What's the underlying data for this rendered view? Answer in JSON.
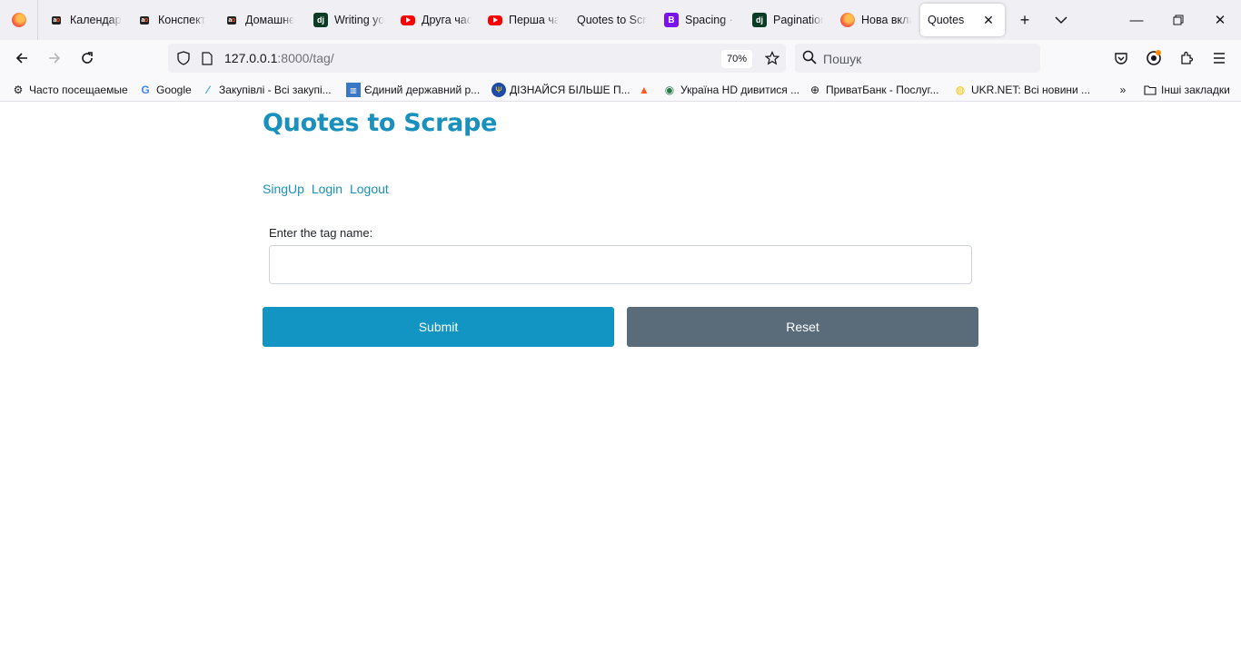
{
  "browser": {
    "tabs": [
      {
        "label": "Календар",
        "icon": "aotv-icon"
      },
      {
        "label": "Конспект",
        "icon": "aotv-icon"
      },
      {
        "label": "Домашнє",
        "icon": "aotv-icon"
      },
      {
        "label": "Writing your",
        "icon": "django-icon"
      },
      {
        "label": "Друга час",
        "icon": "youtube-icon"
      },
      {
        "label": "Перша час",
        "icon": "youtube-icon"
      },
      {
        "label": "Quotes to Scrape",
        "icon": "none"
      },
      {
        "label": "Spacing · B",
        "icon": "bootstrap-icon"
      },
      {
        "label": "Pagination",
        "icon": "django-icon"
      },
      {
        "label": "Нова вкла",
        "icon": "firefox-icon"
      }
    ],
    "active_tab": {
      "label": "Quotes"
    },
    "url": {
      "host": "127.0.0.1",
      "rest": ":8000/tag/"
    },
    "zoom": "70%",
    "search_placeholder": "Пошук",
    "bookmarks": [
      {
        "label": "Часто посещаемые",
        "icon": "gear-icon"
      },
      {
        "label": "Google",
        "icon": "google-icon"
      },
      {
        "label": "Закупівлі - Всі закупі...",
        "icon": "prozorro-icon"
      },
      {
        "label": "Єдиний державний р...",
        "icon": "registry-icon"
      },
      {
        "label": "ДІЗНАЙСЯ БІЛЬШЕ П...",
        "icon": "emblem-icon"
      },
      {
        "label": "",
        "icon": "fox-icon"
      },
      {
        "label": "Україна HD дивитися ...",
        "icon": "eye-icon"
      },
      {
        "label": "ПриватБанк - Послуг...",
        "icon": "globe-icon"
      },
      {
        "label": "UKR.NET: Всі новини ...",
        "icon": "ukrnet-icon"
      }
    ],
    "other_bookmarks": "Інші закладки"
  },
  "page": {
    "title": "Quotes to Scrape",
    "links": {
      "signup": "SingUp",
      "login": "Login",
      "logout": "Logout"
    },
    "form": {
      "label": "Enter the tag name:",
      "value": "",
      "submit": "Submit",
      "reset": "Reset"
    }
  },
  "colors": {
    "accent": "#1a91bd",
    "submit": "#1295c2",
    "reset": "#5a6b7a"
  }
}
